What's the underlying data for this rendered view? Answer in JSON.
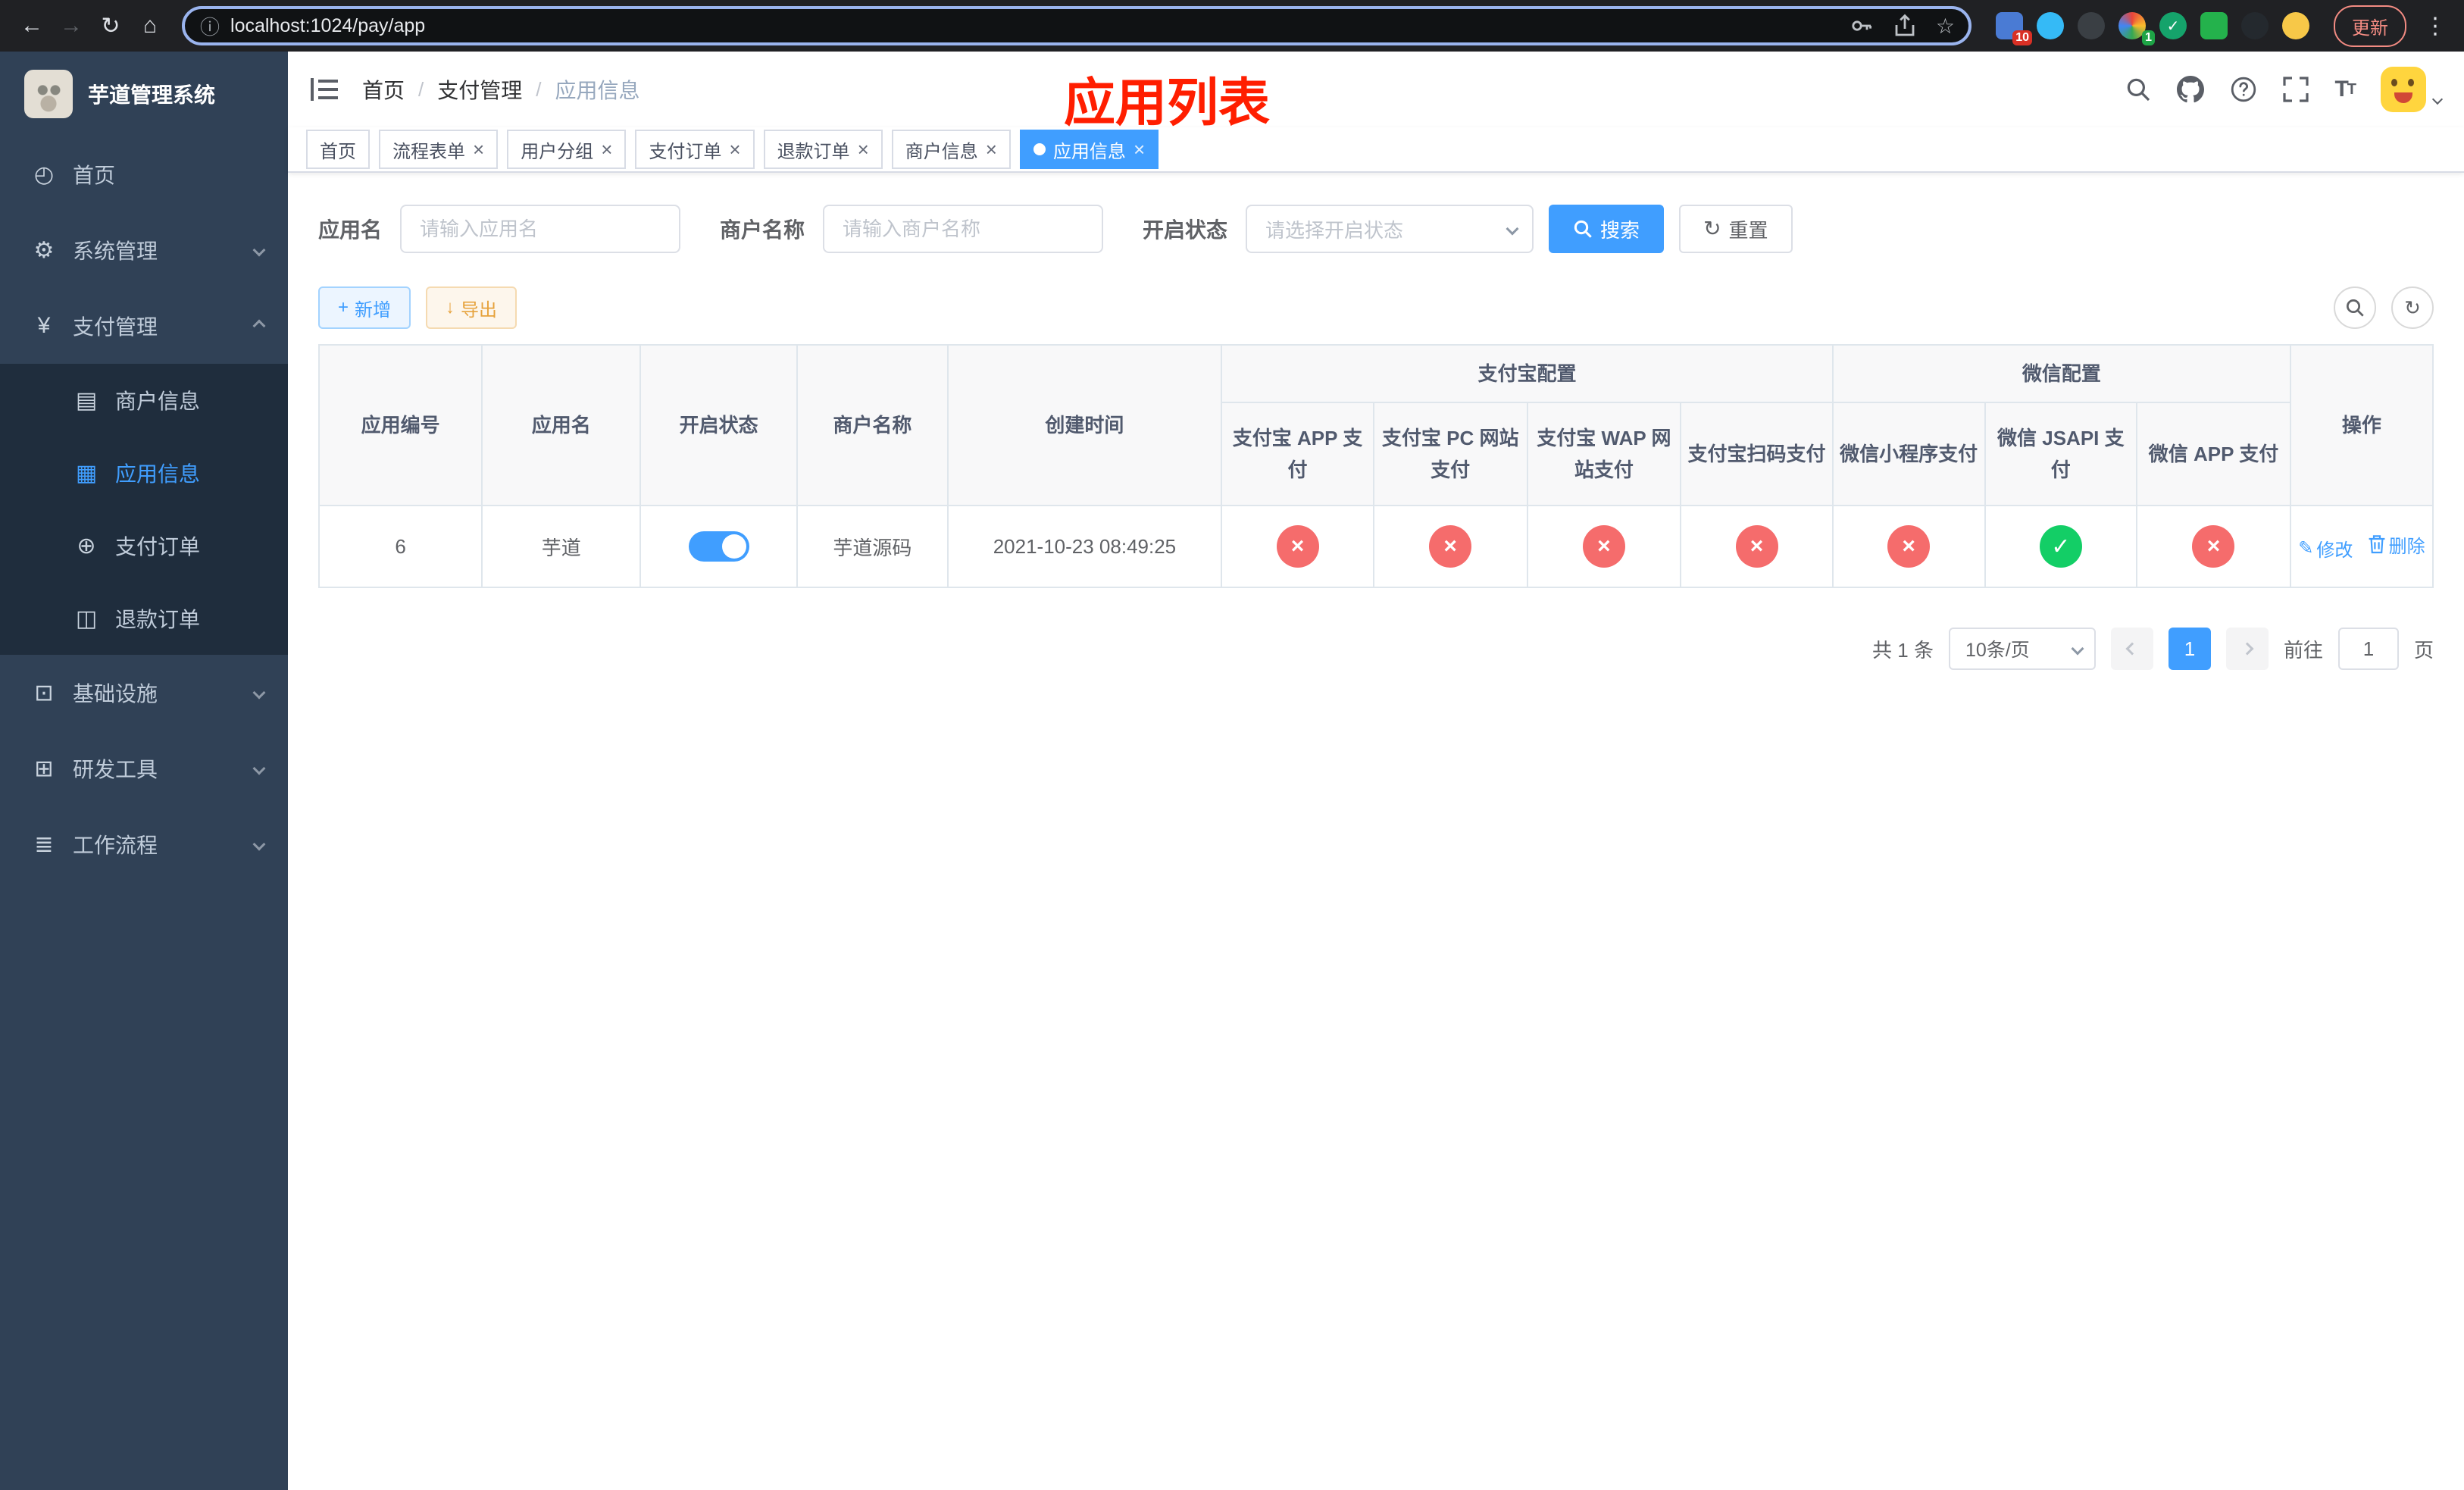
{
  "colors": {
    "accent": "#409eff",
    "danger": "#f56c6c",
    "success": "#13ce66",
    "warning": "#e6a23c",
    "sidebar_bg": "#304156",
    "submenu_bg": "#1f2d3d",
    "annotation": "#ff1e00"
  },
  "browser": {
    "url": "localhost:1024/pay/app",
    "update_label": "更新",
    "ext_badge_first": "10",
    "ext_badge_profile": "1"
  },
  "icons": {
    "back": "←",
    "forward": "→",
    "reload": "↻",
    "home": "⌂",
    "site_info": "ⓘ",
    "bookmark": "☆",
    "overflow": "⋮",
    "dashboard": "◴",
    "gear": "⚙",
    "yen": "¥",
    "merchant": "▤",
    "app_grid": "▦",
    "pay_order": "⊕",
    "refund_order": "◫",
    "infra": "⊡",
    "devtools": "⊞",
    "workflow": "≣",
    "plus": "+",
    "download": "↓",
    "refresh": "↻",
    "edit": "✎",
    "check": "✓",
    "cross": "×"
  },
  "sidebar": {
    "title": "芋道管理系统",
    "items": {
      "home": "首页",
      "system": "系统管理",
      "payment": "支付管理",
      "infra": "基础设施",
      "devtools": "研发工具",
      "workflow": "工作流程"
    },
    "payment_children": {
      "merchant": "商户信息",
      "app": "应用信息",
      "order": "支付订单",
      "refund": "退款订单"
    }
  },
  "header": {
    "breadcrumb": {
      "home": "首页",
      "section": "支付管理",
      "current": "应用信息"
    },
    "annotation": "应用列表"
  },
  "tabs": [
    {
      "label": "首页"
    },
    {
      "label": "流程表单"
    },
    {
      "label": "用户分组"
    },
    {
      "label": "支付订单"
    },
    {
      "label": "退款订单"
    },
    {
      "label": "商户信息"
    },
    {
      "label": "应用信息"
    }
  ],
  "filters": {
    "app_name_label": "应用名",
    "app_name_placeholder": "请输入应用名",
    "merchant_label": "商户名称",
    "merchant_placeholder": "请输入商户名称",
    "status_label": "开启状态",
    "status_placeholder": "请选择开启状态",
    "search_button": "搜索",
    "reset_button": "重置"
  },
  "toolbar": {
    "add_button": "新增",
    "export_button": "导出"
  },
  "table": {
    "headers": {
      "id": "应用编号",
      "name": "应用名",
      "status": "开启状态",
      "merchant": "商户名称",
      "created": "创建时间",
      "alipay_group": "支付宝配置",
      "wechat_group": "微信配置",
      "alipay_app": "支付宝 APP 支付",
      "alipay_pc": "支付宝 PC 网站支付",
      "alipay_wap": "支付宝 WAP 网站支付",
      "alipay_qr": "支付宝扫码支付",
      "wx_mini": "微信小程序支付",
      "wx_jsapi": "微信 JSAPI 支付",
      "wx_app": "微信 APP 支付",
      "actions": "操作"
    },
    "row": {
      "id": "6",
      "name": "芋道",
      "enabled": true,
      "merchant": "芋道源码",
      "created": "2021-10-23 08:49:25",
      "configs": [
        false,
        false,
        false,
        false,
        false,
        true,
        false
      ],
      "edit": "修改",
      "delete": "删除"
    }
  },
  "pagination": {
    "total": "共 1 条",
    "page_size": "10条/页",
    "page": "1",
    "goto_label": "前往",
    "goto_value": "1",
    "goto_unit": "页"
  }
}
